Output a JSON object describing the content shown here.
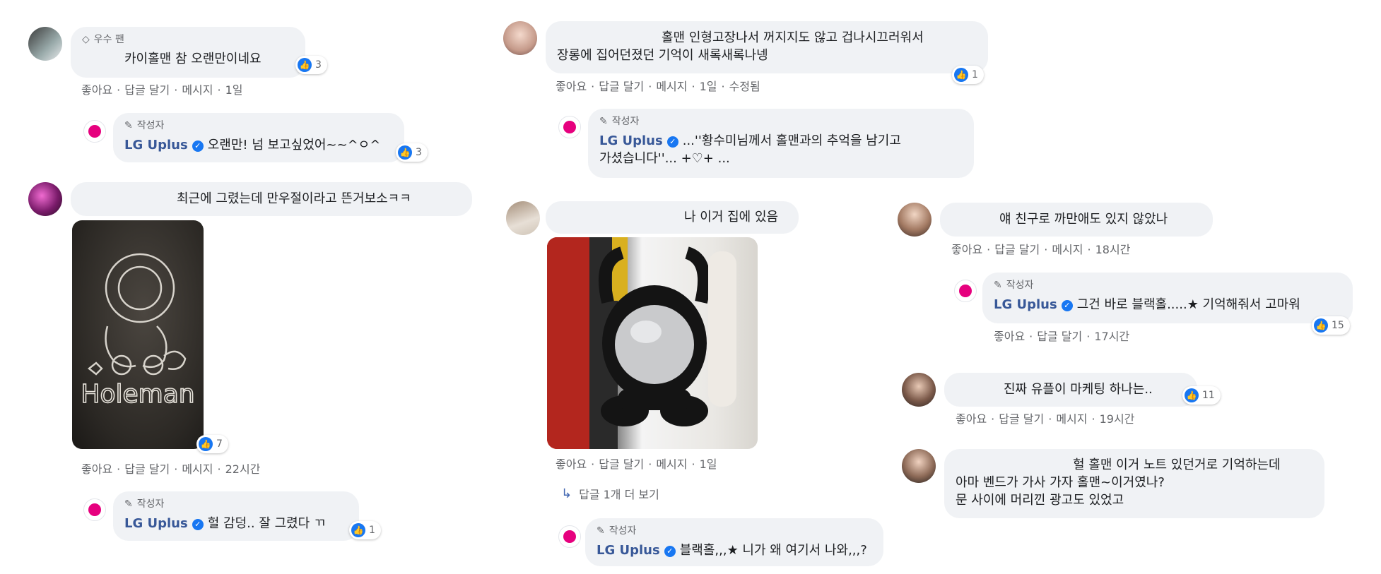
{
  "reaction_color": "#1877f2",
  "c1": {
    "badge": "우수 팬",
    "text": "카이홀맨 참 오랜만이네요",
    "reactions": "3",
    "actions": [
      "좋아요",
      "답글 달기",
      "메시지",
      "1일"
    ]
  },
  "r1": {
    "author_tag": "작성자",
    "name": "LG Uplus",
    "text": "오랜만! 넘 보고싶었어~~^ㅇ^",
    "reactions": "3"
  },
  "c2": {
    "text": "최근에 그렸는데 만우절이라고 뜬거보소ㅋㅋ",
    "photo_caption": "Holeman",
    "reactions": "7",
    "actions": [
      "좋아요",
      "답글 달기",
      "메시지",
      "22시간"
    ]
  },
  "r2": {
    "author_tag": "작성자",
    "name": "LG Uplus",
    "text": "헐 감덩.. 잘 그렸다 ㄲ",
    "reactions": "1"
  },
  "c3": {
    "text_line1": "홀맨 인형고장나서 꺼지지도 않고 겁나시끄러워서",
    "text_line2": "장롱에 집어던졌던 기억이 새록새록나넹",
    "reactions": "1",
    "actions": [
      "좋아요",
      "답글 달기",
      "메시지",
      "1일",
      "수정됨"
    ]
  },
  "r3": {
    "author_tag": "작성자",
    "name": "LG Uplus",
    "text_line1": "...''황수미님께서 홀맨과의 추억을 남기고",
    "text_line2": "가셨습니다''... +♡+ ..."
  },
  "c4": {
    "text": "나 이거 집에 있음",
    "actions": [
      "좋아요",
      "답글 달기",
      "메시지",
      "1일"
    ],
    "more_replies": "답글 1개 더 보기"
  },
  "r4": {
    "author_tag": "작성자",
    "name": "LG Uplus",
    "text": "블랙홀,,,★ 니가 왜 여기서 나와,,,?"
  },
  "c5": {
    "text": "얘 친구로 까만애도 있지 않았나",
    "actions": [
      "좋아요",
      "답글 달기",
      "메시지",
      "18시간"
    ]
  },
  "r5": {
    "author_tag": "작성자",
    "name": "LG Uplus",
    "text": "그건 바로 블랙홀.....★ 기억해줘서 고마워",
    "reactions": "15",
    "actions": [
      "좋아요",
      "답글 달기",
      "17시간"
    ]
  },
  "c6": {
    "text": "진짜 유플이 마케팅 하나는..",
    "reactions": "11",
    "actions": [
      "좋아요",
      "답글 달기",
      "메시지",
      "19시간"
    ]
  },
  "c7": {
    "text_line1": "헐 홀맨 이거 노트 있던거로 기억하는데",
    "text_line2": "아마 벤드가 가사 가자 홀맨~이거였나?",
    "text_line3": "문 사이에 머리낀 광고도 있었고"
  }
}
